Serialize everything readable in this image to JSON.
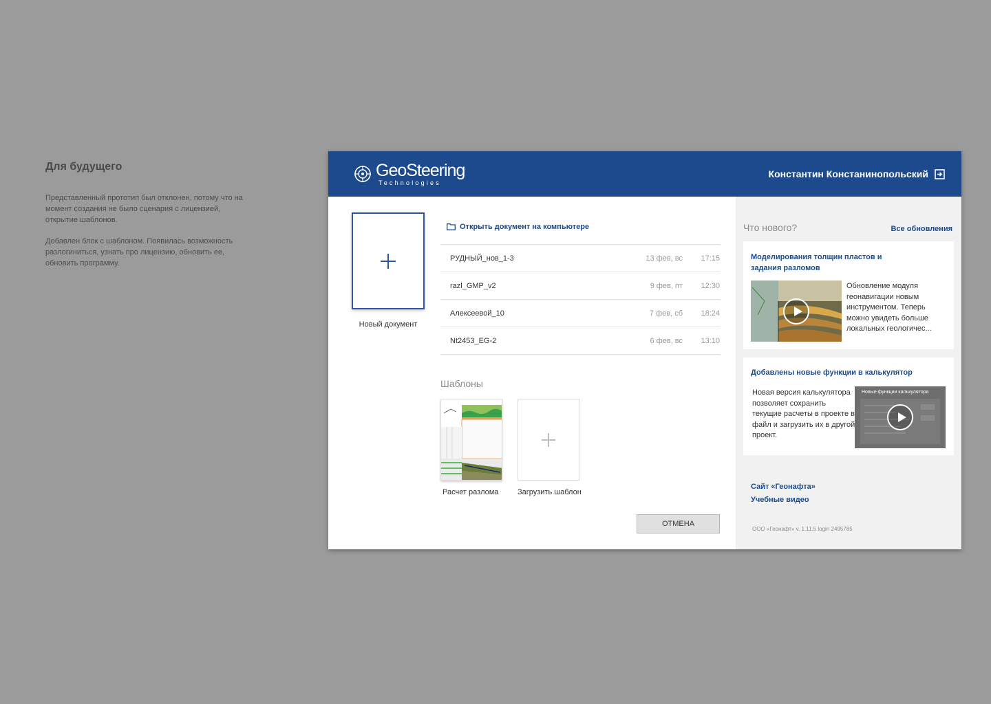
{
  "note": {
    "title": "Для будущего",
    "paragraph1": "Представленный прототип был отклонен, потому что на момент создания не было сценария с лицензией, открытие шаблонов.",
    "paragraph2": "Добавлен блок с шаблоном. Появилась возможность разлогиниться, узнать про лицензию, обновить ее, обновить программу."
  },
  "header": {
    "logo_main": "GeoSteering",
    "logo_sub": "Technologies",
    "user_name": "Константин Констанинопольский",
    "logout_icon": "logout-icon",
    "background": "#1c4a8c"
  },
  "main": {
    "new_document_label": "Новый документ",
    "open_link": "Открыть документ на компьютере",
    "recent": [
      {
        "name": "РУДНЫЙ_нов_1-3",
        "date": "13 фев, вс",
        "time": "17:15"
      },
      {
        "name": "razl_GMP_v2",
        "date": "9 фев, пт",
        "time": "12:30"
      },
      {
        "name": "Алексеевой_10",
        "date": "7 фев, сб",
        "time": "18:24"
      },
      {
        "name": "Nt2453_EG-2",
        "date": "6 фев, вс",
        "time": "13:10"
      }
    ],
    "templates_title": "Шаблоны",
    "templates": [
      {
        "label": "Расчет разлома"
      },
      {
        "label": "Загрузить шаблон"
      }
    ],
    "cancel_label": "ОТМЕНА"
  },
  "sidebar": {
    "news_title": "Что нового?",
    "all_updates": "Все обновления",
    "cards": [
      {
        "title": "Моделирования толщин пластов и задания разломов",
        "text": "Обновление модуля геонавигации новым инструментом. Теперь можно увидеть больше локальных геологичес..."
      },
      {
        "title": "Добавлены новые функции в калькулятор",
        "text": "Новая версия калькулятора позволяет сохранить текущие расчеты в проекте в файл и загрузить их в другой проект.",
        "video_caption": "Новые функции калькулятора"
      }
    ],
    "links": [
      "Сайт «Геонафта»",
      "Учебные видео"
    ],
    "version": "ООО «Геонафт» v. 1.11.5 login 2495785"
  }
}
